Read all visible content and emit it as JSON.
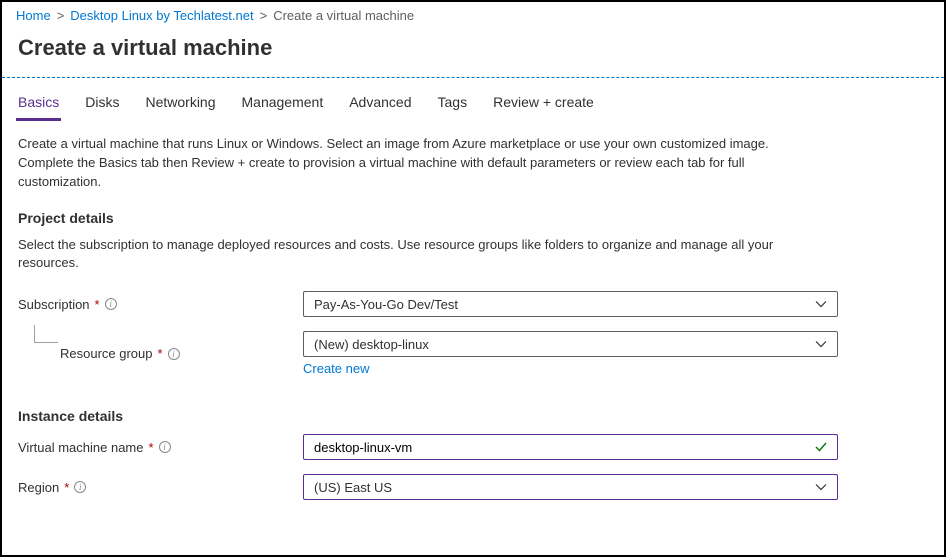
{
  "breadcrumb": {
    "home": "Home",
    "product": "Desktop Linux by Techlatest.net",
    "current": "Create a virtual machine"
  },
  "page_title": "Create a virtual machine",
  "tabs": [
    {
      "label": "Basics",
      "active": true
    },
    {
      "label": "Disks",
      "active": false
    },
    {
      "label": "Networking",
      "active": false
    },
    {
      "label": "Management",
      "active": false
    },
    {
      "label": "Advanced",
      "active": false
    },
    {
      "label": "Tags",
      "active": false
    },
    {
      "label": "Review + create",
      "active": false
    }
  ],
  "intro_line1": "Create a virtual machine that runs Linux or Windows. Select an image from Azure marketplace or use your own customized image.",
  "intro_line2": "Complete the Basics tab then Review + create to provision a virtual machine with default parameters or review each tab for full customization.",
  "project_details": {
    "title": "Project details",
    "desc": "Select the subscription to manage deployed resources and costs. Use resource groups like folders to organize and manage all your resources.",
    "subscription_label": "Subscription",
    "subscription_value": "Pay-As-You-Go Dev/Test",
    "resource_group_label": "Resource group",
    "resource_group_value": "(New) desktop-linux",
    "create_new": "Create new"
  },
  "instance_details": {
    "title": "Instance details",
    "vm_name_label": "Virtual machine name",
    "vm_name_value": "desktop-linux-vm",
    "region_label": "Region",
    "region_value": "(US) East US"
  }
}
